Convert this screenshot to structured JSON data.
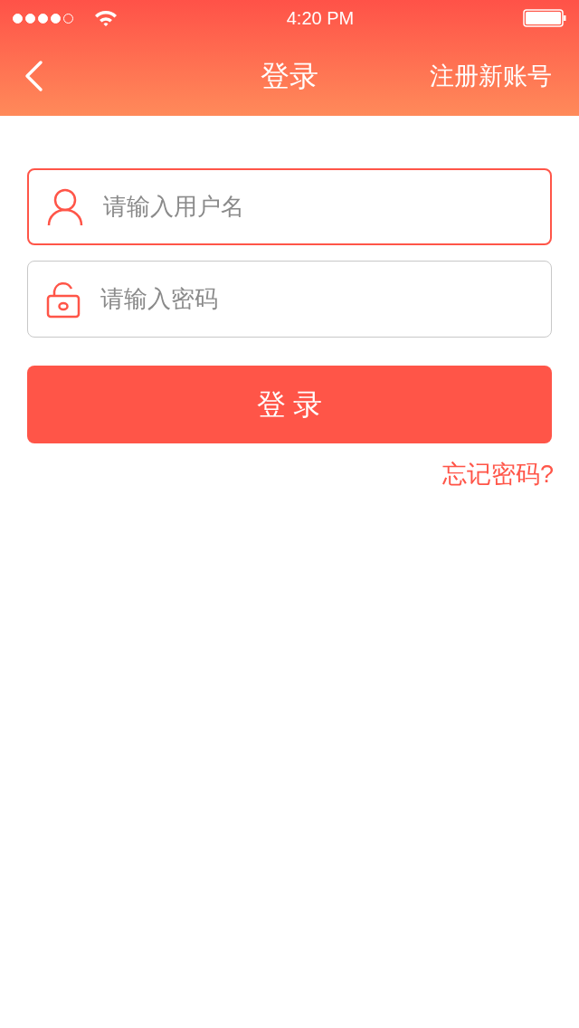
{
  "status_bar": {
    "signal_dots": [
      {
        "filled": true
      },
      {
        "filled": true
      },
      {
        "filled": true
      },
      {
        "filled": true
      },
      {
        "filled": false
      }
    ],
    "time": "4:20 PM"
  },
  "nav": {
    "title": "登录",
    "action": "注册新账号"
  },
  "fields": [
    {
      "kind": "user",
      "placeholder": "请输入用户名",
      "focused": true
    },
    {
      "kind": "password",
      "placeholder": "请输入密码",
      "focused": false
    }
  ],
  "login_button": "登 录",
  "forgot_link": "忘记密码?"
}
